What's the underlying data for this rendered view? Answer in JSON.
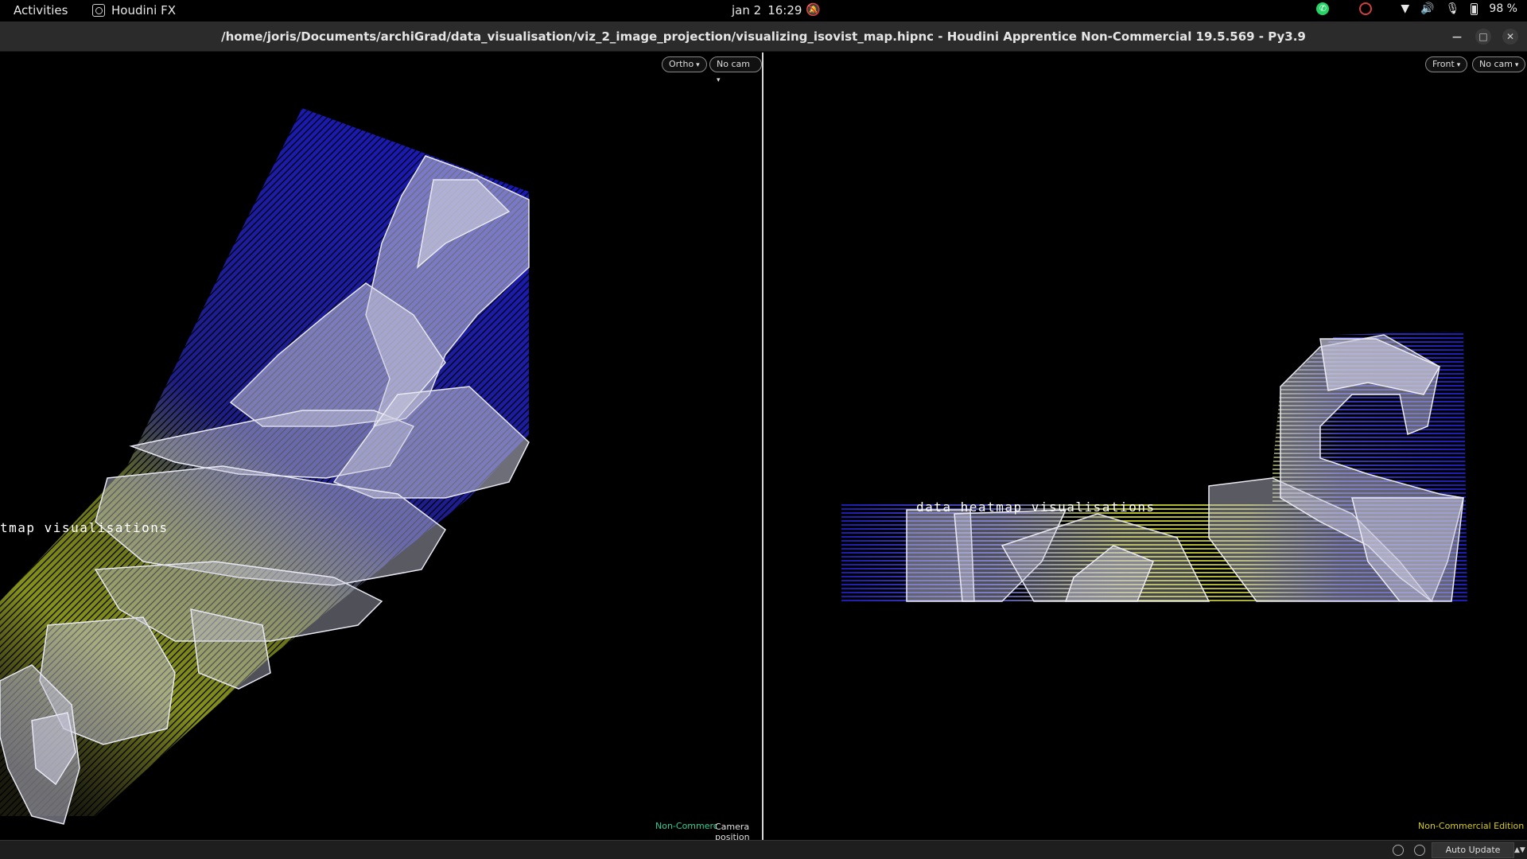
{
  "topbar": {
    "activities": "Activities",
    "app_name": "Houdini FX",
    "date": "jan 2",
    "time": "16:29",
    "battery": "98 %"
  },
  "window": {
    "title": "/home/joris/Documents/archiGrad/data_visualisation/viz_2_image_projection/visualizing_isovist_map.hipnc - Houdini Apprentice Non-Commercial 19.5.569 - Py3.9"
  },
  "left_viewport": {
    "view_menu": "Ortho",
    "cam_menu": "No cam",
    "overlay_label": "tmap visualisations",
    "status_green": "Non-Commerc",
    "status_message": "Camera position moved."
  },
  "right_viewport": {
    "view_menu": "Front",
    "cam_menu": "No cam",
    "overlay_label": "data heatmap visualisations",
    "status_yellow": "Non-Commercial Edition"
  },
  "bottombar": {
    "auto_update": "Auto Update"
  },
  "colors": {
    "heat_low": "#2a2ad8",
    "heat_high": "#d8e02a",
    "geometry": "#d0d0e0"
  },
  "icons": [
    "whatsapp-icon",
    "chrome-icon",
    "wifi-icon",
    "volume-icon",
    "mic-icon",
    "battery-icon",
    "bell-icon"
  ]
}
